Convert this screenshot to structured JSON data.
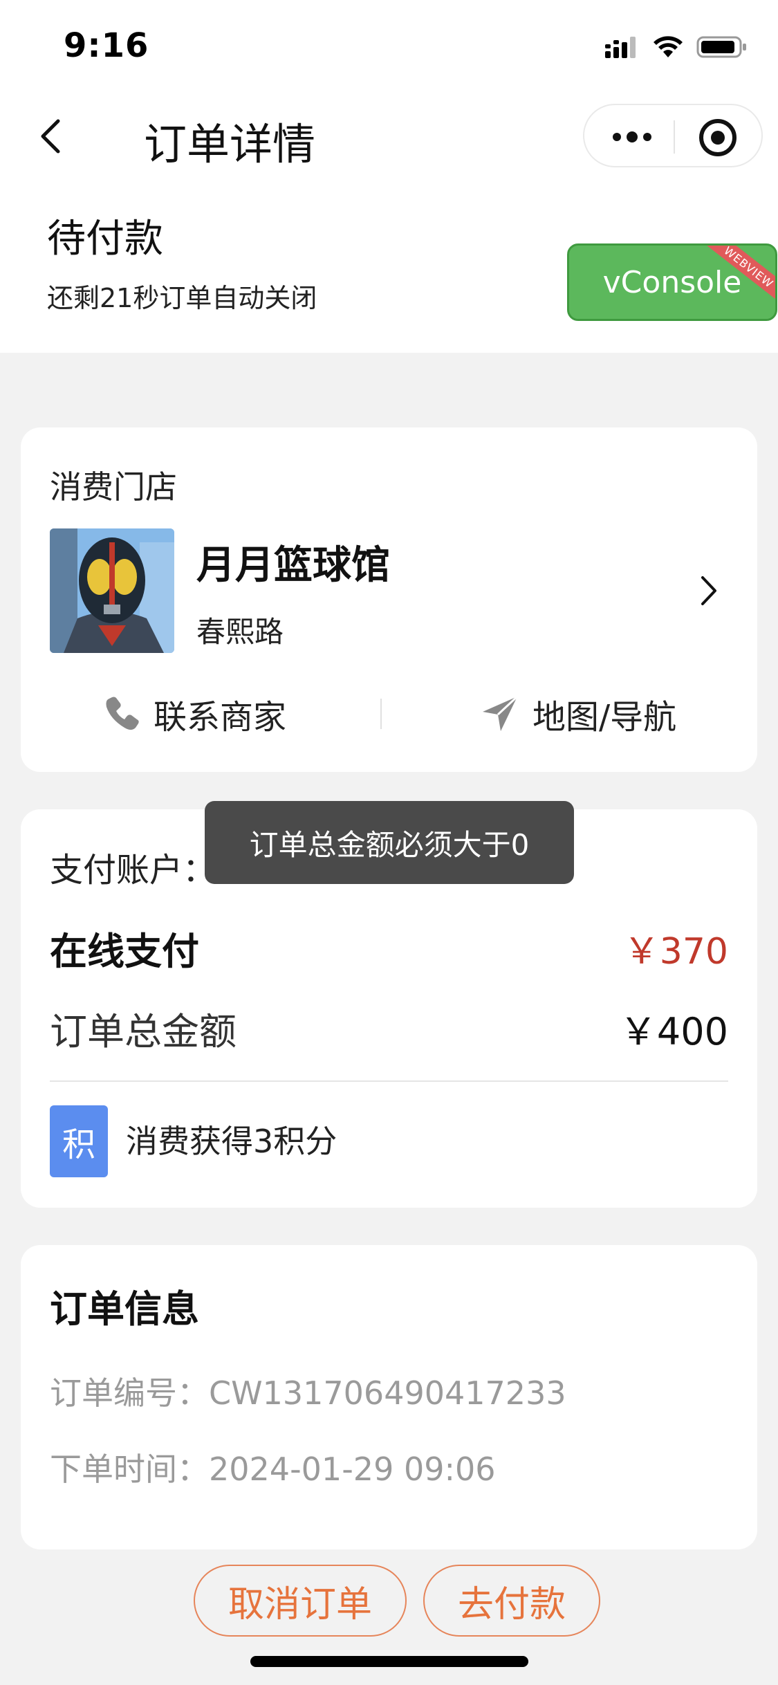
{
  "status_bar": {
    "time": "9:16"
  },
  "nav": {
    "title": "订单详情"
  },
  "order": {
    "status": "待付款",
    "countdown": "还剩21秒订单自动关闭"
  },
  "vconsole": {
    "label": "vConsole",
    "ribbon": "WEBVIEW",
    "color": "#5cb85c"
  },
  "store": {
    "heading": "消费门店",
    "name": "月月篮球馆",
    "address": "春熙路",
    "contact_label": "联系商家",
    "map_label": "地图/导航"
  },
  "payment": {
    "account_label": "支付账户：",
    "online_label": "在线支付",
    "online_amount": "￥370",
    "total_label": "订单总金额",
    "total_amount": "￥400",
    "points_badge": "积",
    "points_text": "消费获得3积分",
    "accent_color": "#c0392b"
  },
  "toast": {
    "message": "订单总金额必须大于0"
  },
  "order_info": {
    "heading": "订单信息",
    "order_no": "订单编号：CW131706490417233",
    "order_time": "下单时间：2024-01-29 09:06"
  },
  "actions": {
    "cancel_label": "取消订单",
    "pay_label": "去付款",
    "color": "#e6733c"
  }
}
